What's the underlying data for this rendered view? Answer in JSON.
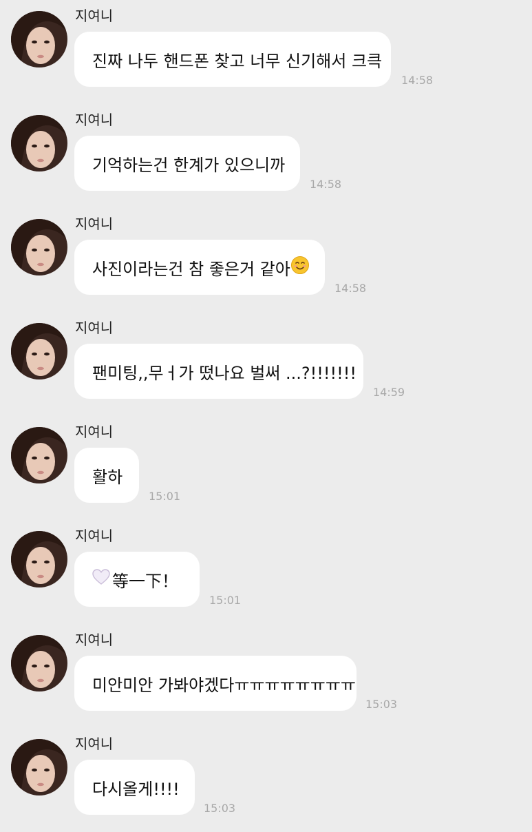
{
  "chat": {
    "messages": [
      {
        "sender": "지여니",
        "text": "진짜 나두 핸드폰 찾고 너무 신기해서 크큭",
        "time": "14:58"
      },
      {
        "sender": "지여니",
        "text": "기억하는건 한계가 있으니까",
        "time": "14:58"
      },
      {
        "sender": "지여니",
        "text": "사진이라는건 참 좋은거 같아",
        "emoji_after": "smiling-face-emoji",
        "time": "14:58"
      },
      {
        "sender": "지여니",
        "text": "팬미팅,,무ㅓ가 떴나요 벌써 ...?!!!!!!!",
        "time": "14:59"
      },
      {
        "sender": "지여니",
        "text": "활하",
        "time": "15:01"
      },
      {
        "sender": "지여니",
        "emoji_before": "white-heart-emoji",
        "text": "等一下！",
        "time": "15:01"
      },
      {
        "sender": "지여니",
        "text": "미안미안 가봐야겠다ㅠㅠㅠㅠㅠㅠㅠㅠ",
        "time": "15:03"
      },
      {
        "sender": "지여니",
        "text": "다시올게!!!!",
        "time": "15:03"
      }
    ]
  },
  "colors": {
    "background": "#ececec",
    "bubble": "#ffffff",
    "timestamp": "#a8a8a8"
  }
}
